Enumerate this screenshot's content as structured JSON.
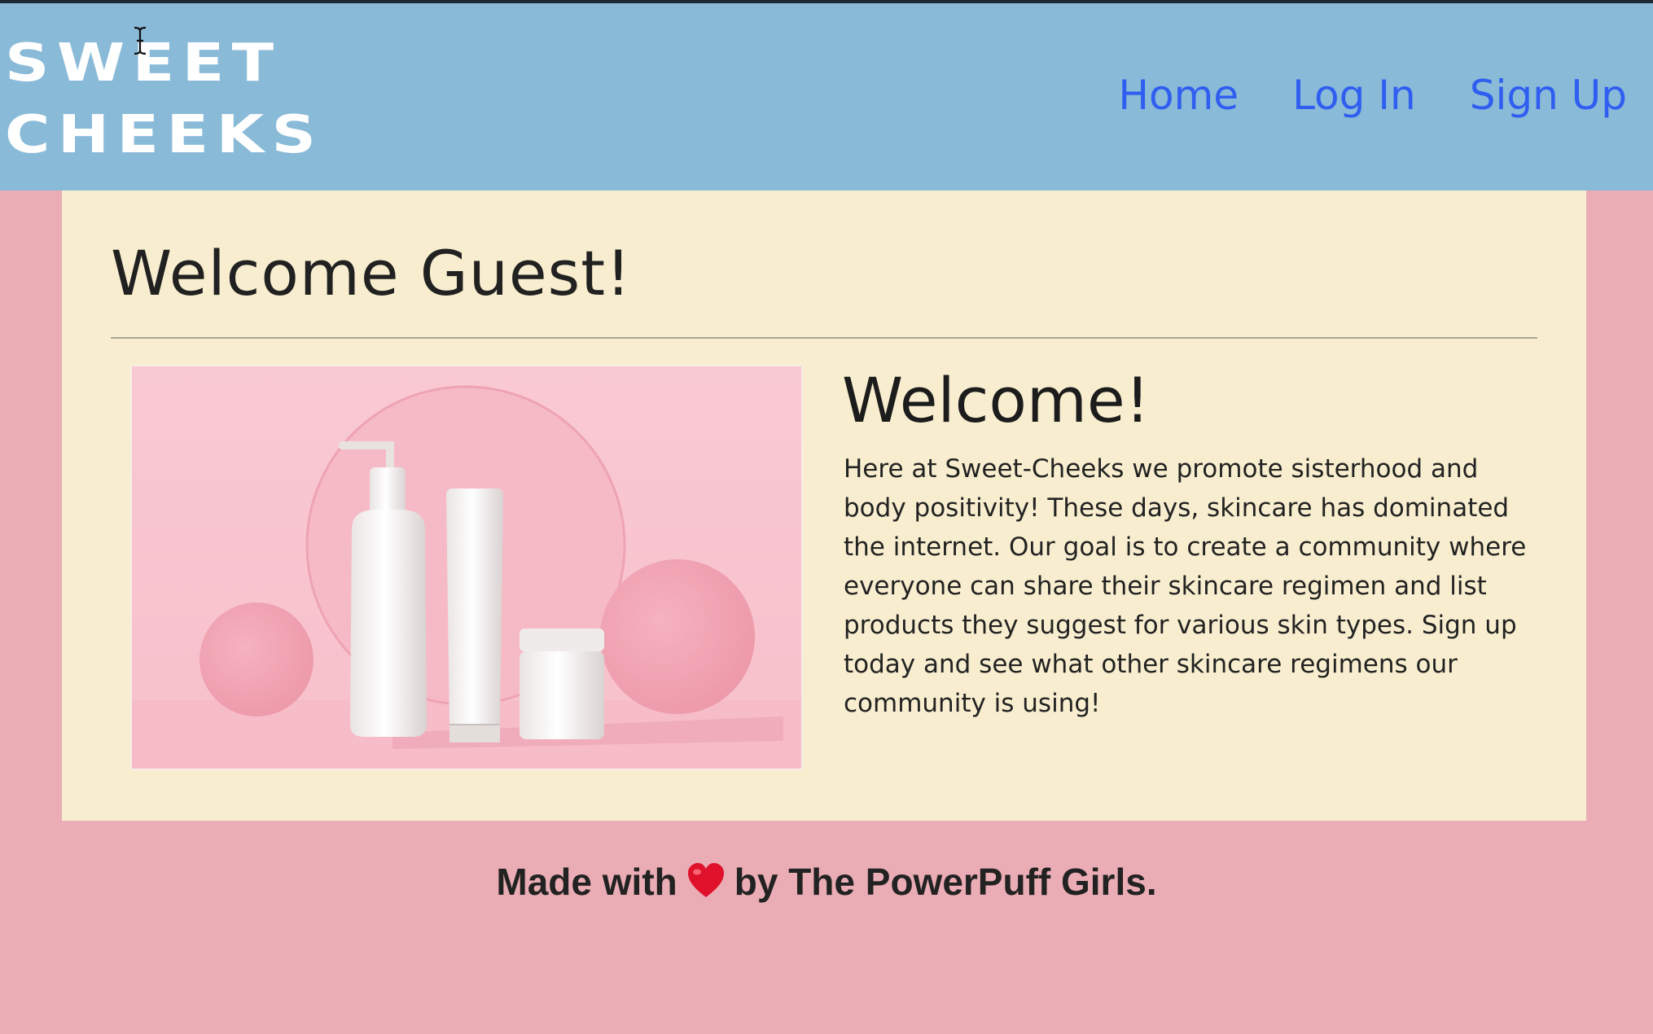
{
  "navbar": {
    "logo_line1": "SWEET",
    "logo_line2": "CHEEKS",
    "links": [
      {
        "label": "Home"
      },
      {
        "label": "Log In"
      },
      {
        "label": "Sign Up"
      }
    ]
  },
  "main": {
    "title": "Welcome Guest!",
    "image_alt": "Pink skincare products",
    "heading": "Welcome!",
    "paragraph": "Here at Sweet-Cheeks we promote sisterhood and body positivity! These days, skincare has dominated the internet. Our goal is to create a community where everyone can share their skincare regimen and list products they suggest for various skin types. Sign up today and see what other skincare regimens our community is using!"
  },
  "footer": {
    "text_before": "Made with",
    "text_after": "by The PowerPuff Girls."
  },
  "colors": {
    "background": "#ebadb5",
    "navbar": "#89bad8",
    "card": "#f8eecf",
    "link": "#2f5ef0",
    "heart": "#e0112b"
  }
}
